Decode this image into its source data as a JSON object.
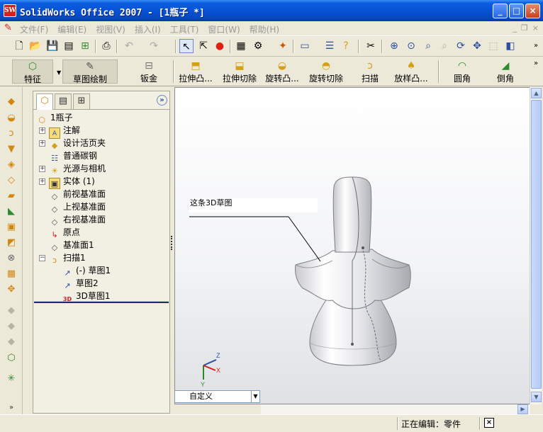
{
  "window": {
    "app_icon_label": "SW",
    "title": "SolidWorks Office 2007 - [1瓶子 *]",
    "minimize_glyph": "_",
    "maximize_glyph": "□",
    "close_glyph": "×"
  },
  "menu": {
    "items": [
      "文件(F)",
      "编辑(E)",
      "视图(V)",
      "插入(I)",
      "工具(T)",
      "窗口(W)",
      "帮助(H)"
    ]
  },
  "command_manager": {
    "tabs": [
      {
        "label": "特征",
        "icon": "feature-icon"
      },
      {
        "label": "草图绘制",
        "icon": "sketch-icon"
      },
      {
        "label": "钣金",
        "icon": "sheetmetal-icon"
      }
    ],
    "commands": [
      {
        "label": "拉伸凸...",
        "icon": "extrude-boss-icon"
      },
      {
        "label": "拉伸切除",
        "icon": "extrude-cut-icon"
      },
      {
        "label": "旋转凸...",
        "icon": "revolve-boss-icon"
      },
      {
        "label": "旋转切除",
        "icon": "revolve-cut-icon"
      },
      {
        "label": "扫描",
        "icon": "sweep-icon"
      },
      {
        "label": "放样凸...",
        "icon": "loft-icon"
      },
      {
        "label": "圆角",
        "icon": "fillet-icon"
      },
      {
        "label": "倒角",
        "icon": "chamfer-icon"
      }
    ]
  },
  "feature_tree": {
    "nodes": [
      {
        "label": "1瓶子",
        "icon": "part-icon"
      },
      {
        "label": "注解",
        "icon": "annotations-icon"
      },
      {
        "label": "设计活页夹",
        "icon": "design-binder-icon"
      },
      {
        "label": "普通碳钢",
        "icon": "material-icon"
      },
      {
        "label": "光源与相机",
        "icon": "lights-cameras-icon"
      },
      {
        "label": "实体 (1)",
        "icon": "solid-bodies-icon"
      },
      {
        "label": "前视基准面",
        "icon": "plane-icon"
      },
      {
        "label": "上视基准面",
        "icon": "plane-icon"
      },
      {
        "label": "右视基准面",
        "icon": "plane-icon"
      },
      {
        "label": "原点",
        "icon": "origin-icon"
      },
      {
        "label": "基准面1",
        "icon": "plane-icon"
      },
      {
        "label": "扫描1",
        "icon": "sweep-icon"
      },
      {
        "label": "(-) 草图1",
        "icon": "sketch-icon"
      },
      {
        "label": "草图2",
        "icon": "sketch-icon"
      },
      {
        "label": "3D草图1",
        "icon": "3d-sketch-icon"
      }
    ]
  },
  "graphics": {
    "callout_text": "这条3D草图",
    "axis_labels": {
      "x": "X",
      "y": "Y",
      "z": "Z"
    }
  },
  "configuration": {
    "selected": "自定义"
  },
  "status": {
    "text": "正在编辑：零件"
  }
}
